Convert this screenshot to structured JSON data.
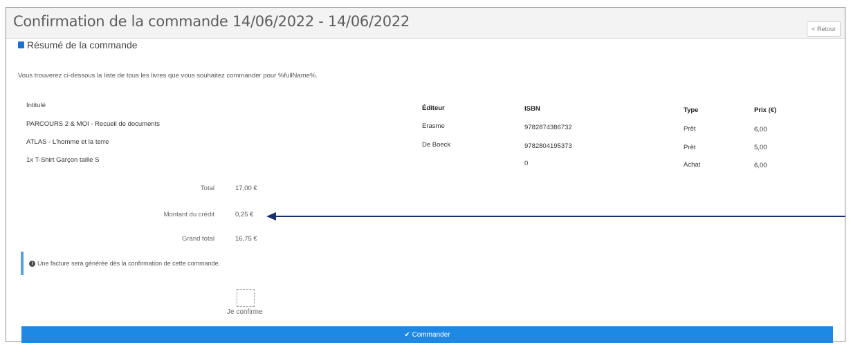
{
  "header": {
    "title": "Confirmation de la commande 14/06/2022 - 14/06/2022",
    "back_label": "< Retour"
  },
  "summary": {
    "title": "Résumé de la commande",
    "intro": "Vous trouverez ci-dessous la liste de tous les livres que vous souhaitez commander pour %fullName%.",
    "columns": {
      "title": "Intitulé",
      "publisher": "Éditeur",
      "isbn": "ISBN",
      "type": "Type",
      "price": "Prix (€)"
    },
    "rows": [
      {
        "title": "PARCOURS 2 & MOI - Recueil de documents",
        "publisher": "Erasme",
        "isbn": "9782874386732",
        "type": "Prêt",
        "price": "6,00"
      },
      {
        "title": "ATLAS - L'homme et la terre",
        "publisher": "De Boeck",
        "isbn": "9782804195373",
        "type": "Prêt",
        "price": "5,00"
      },
      {
        "title": "1x T-Shirt Garçon taille S",
        "publisher": "",
        "isbn": "0",
        "type": "Achat",
        "price": "6,00"
      }
    ],
    "totals": {
      "total_label": "Total",
      "total_value": "17,00 €",
      "credit_label": "Montant du crédit",
      "credit_value": "0,25 €",
      "grand_label": "Grand total",
      "grand_value": "16,75 €"
    }
  },
  "info": {
    "message": "Une facture sera générée dès la confirmation de cette commande."
  },
  "confirm": {
    "label": "Je confirme"
  },
  "actions": {
    "submit_label": "✔ Commander"
  },
  "colors": {
    "accent": "#1e88e5",
    "arrow": "#1b2f6b",
    "info_border": "#5a9ee2"
  }
}
